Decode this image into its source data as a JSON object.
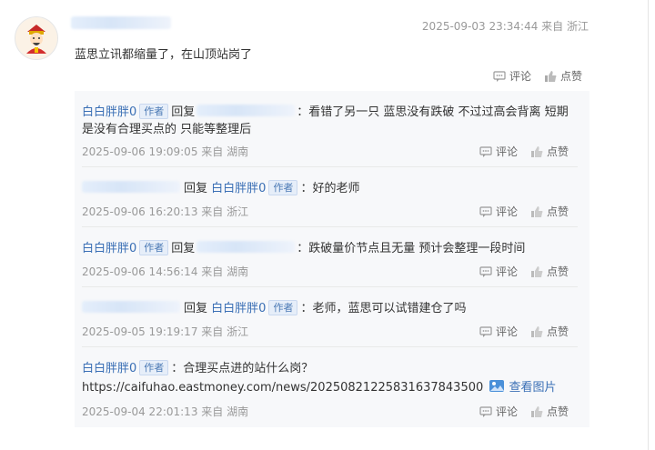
{
  "post": {
    "meta": "2025-09-03 23:34:44 来自 浙江",
    "text": "蓝思立讯都缩量了，在山顶站岗了",
    "comment_label": "评论",
    "like_label": "点赞"
  },
  "labels": {
    "reply": "回复",
    "author_badge": "作者",
    "comment": "评论",
    "like": "点赞",
    "colon": "：",
    "view_image": "查看图片"
  },
  "replies": [
    {
      "user": "白白胖胖0",
      "line1": "：看错了另一只 蓝思没有跌破 不过过高会背离 短期",
      "line2": "是没有合理买点的 只能等整理后",
      "meta": "2025-09-06 19:09:05   来自  湖南"
    },
    {
      "target_user": "白白胖胖0",
      "text": "：好的老师",
      "meta": "2025-09-06 16:20:13   来自  浙江"
    },
    {
      "user": "白白胖胖0",
      "text": "：跌破量价节点且无量 预计会整理一段时间",
      "meta": "2025-09-06 14:56:14   来自  湖南"
    },
    {
      "target_user": "白白胖胖0",
      "text": "：老师，蓝思可以试错建仓了吗",
      "meta": "2025-09-05 19:19:17   来自  浙江"
    },
    {
      "user": "白白胖胖0",
      "text": "：合理买点进的站什么岗？",
      "link": "https://caifuhao.eastmoney.com/news/20250821225831637843500",
      "meta": "2025-09-04 22:01:13   来自  湖南"
    }
  ],
  "colors": {
    "link": "#3a6fb5",
    "meta": "#999999",
    "reply_bg": "#f7f8fa"
  },
  "icons": [
    "avatar-god-of-wealth",
    "comment-icon",
    "like-icon",
    "image-icon"
  ]
}
